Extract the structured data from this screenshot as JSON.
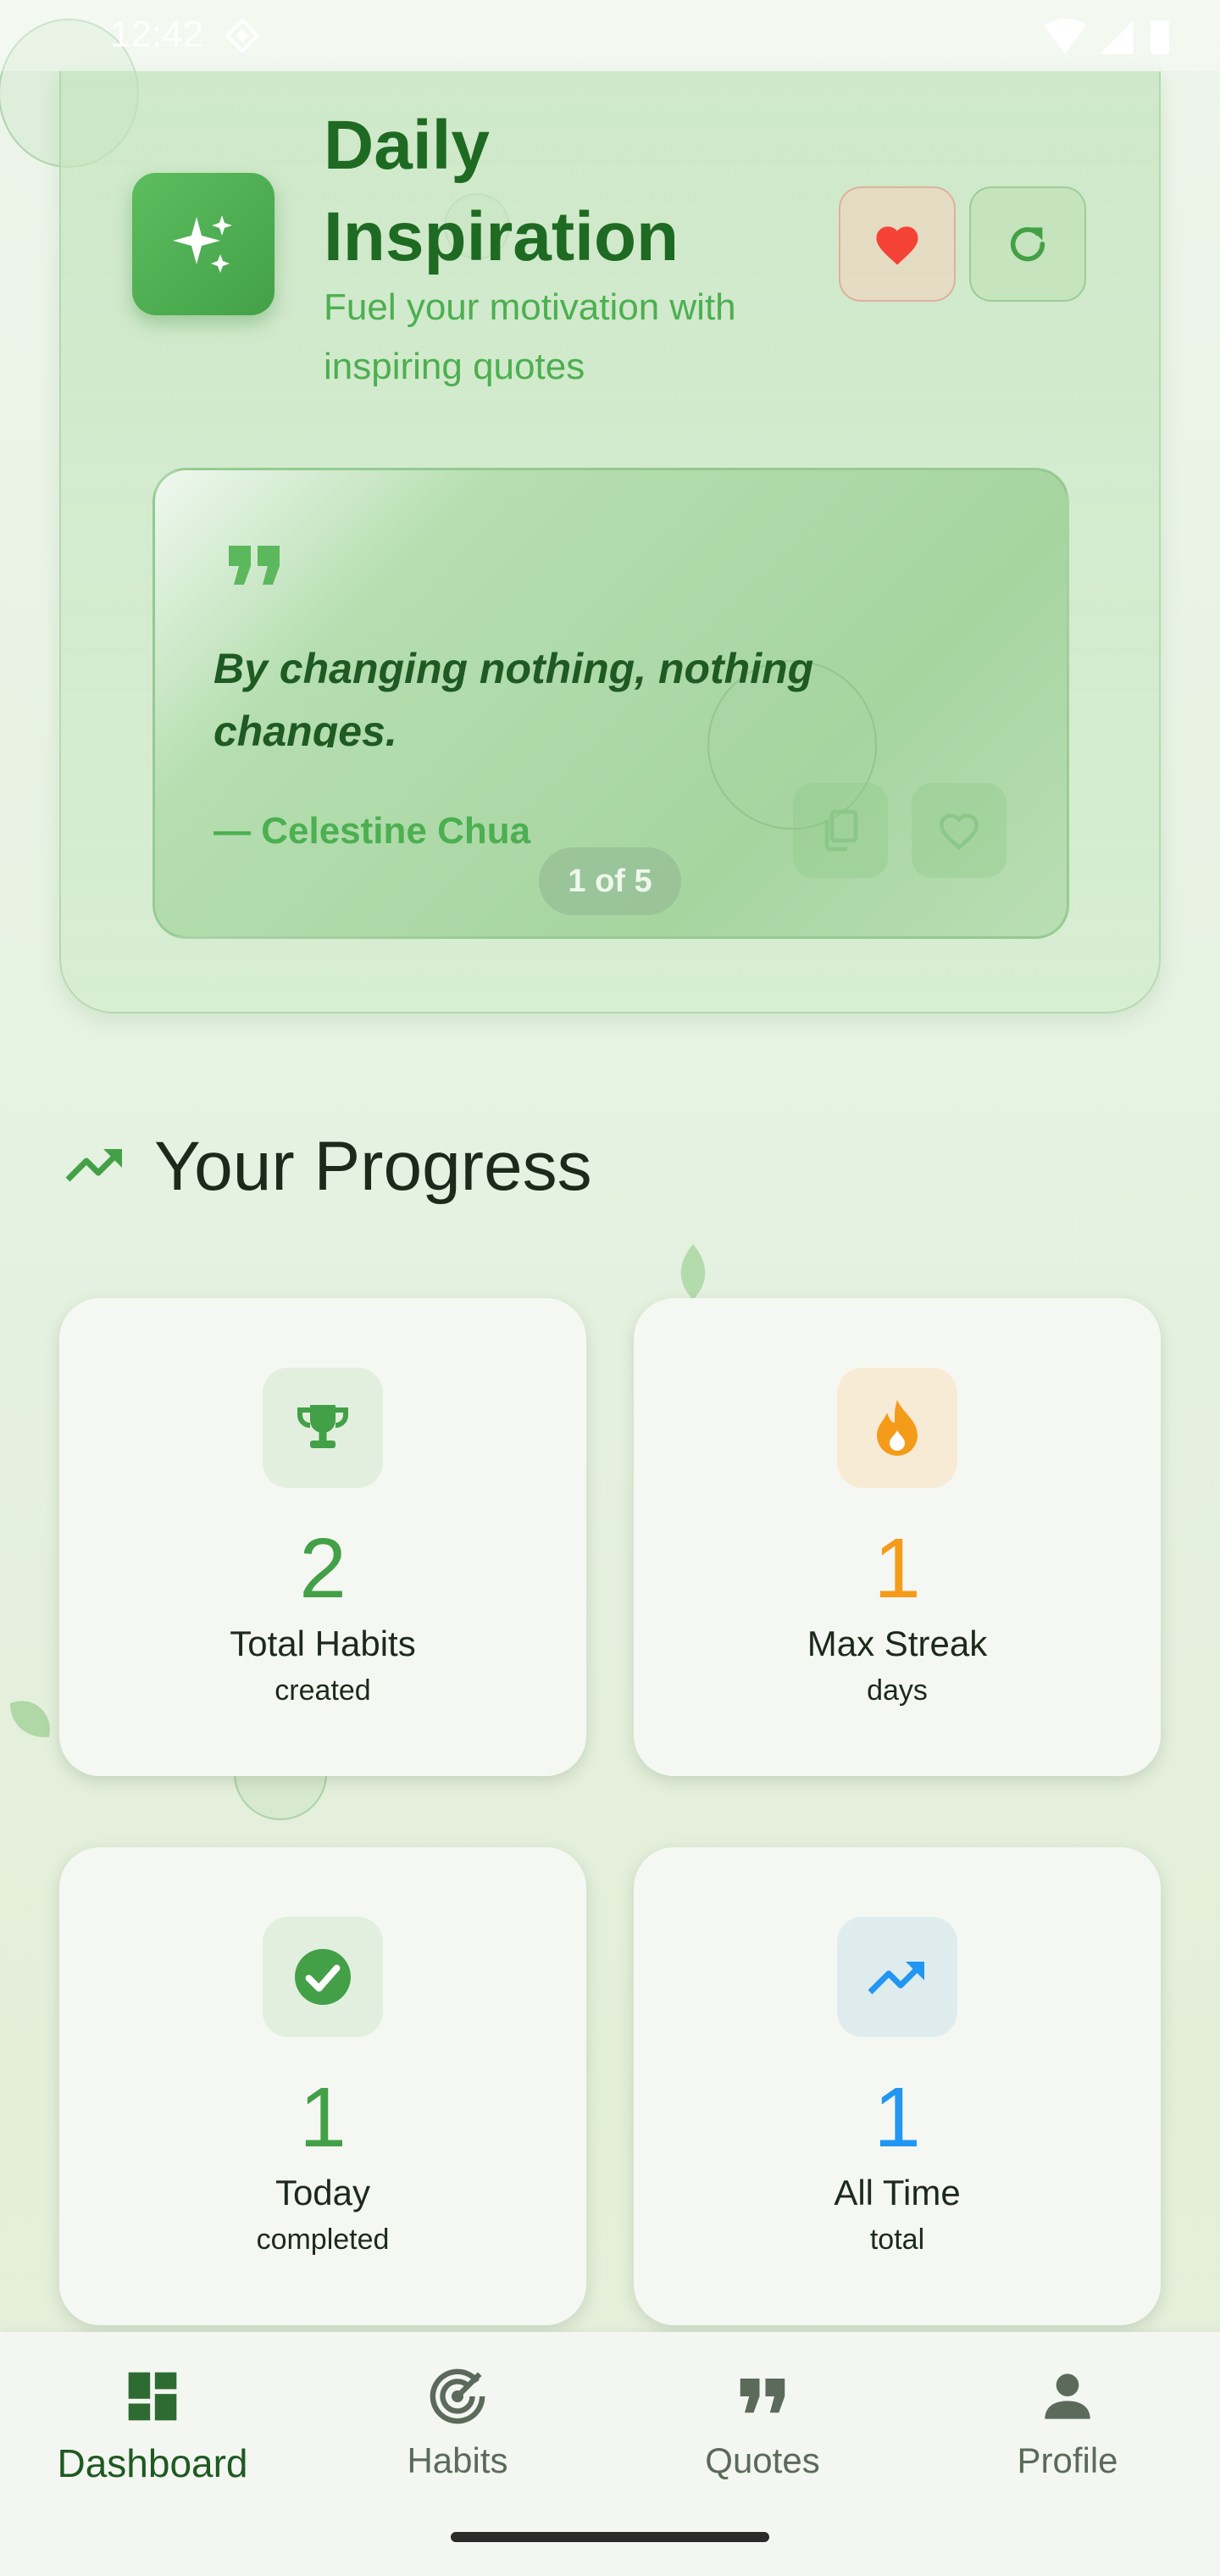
{
  "status_bar": {
    "time": "12:42"
  },
  "inspiration": {
    "title_line1": "Daily",
    "title_line2": "Inspiration",
    "subtitle_line1": "Fuel your motivation with",
    "subtitle_line2": "inspiring quotes",
    "quote": {
      "text_line1": "By changing nothing, nothing",
      "text_line2": "changes.",
      "author": "— Celestine Chua",
      "page_indicator": "1 of 5"
    }
  },
  "progress": {
    "title": "Your Progress",
    "stats": [
      {
        "value": "2",
        "label": "Total Habits",
        "sub": "created",
        "color": "#43a047",
        "icon": "trophy-icon"
      },
      {
        "value": "1",
        "label": "Max Streak",
        "sub": "days",
        "color": "#f59b1a",
        "icon": "flame-icon"
      },
      {
        "value": "1",
        "label": "Today",
        "sub": "completed",
        "color": "#43a047",
        "icon": "check-circle-icon"
      },
      {
        "value": "1",
        "label": "All Time",
        "sub": "total",
        "color": "#2196f3",
        "icon": "trending-up-icon"
      }
    ]
  },
  "nav": {
    "items": [
      {
        "label": "Dashboard",
        "icon": "dashboard-icon",
        "active": true
      },
      {
        "label": "Habits",
        "icon": "target-icon",
        "active": false
      },
      {
        "label": "Quotes",
        "icon": "quote-icon",
        "active": false
      },
      {
        "label": "Profile",
        "icon": "person-icon",
        "active": false
      }
    ]
  },
  "colors": {
    "accent": "#43a047",
    "dark_green": "#1e6a22",
    "orange": "#f59b1a",
    "blue": "#2196f3",
    "heart_red": "#f44336"
  }
}
